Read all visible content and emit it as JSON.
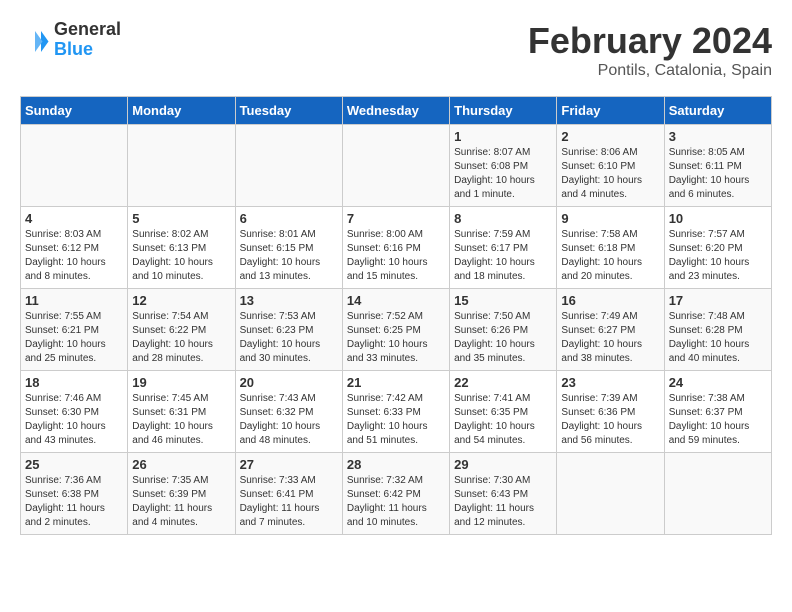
{
  "header": {
    "logo": {
      "general": "General",
      "blue": "Blue"
    },
    "month": "February 2024",
    "location": "Pontils, Catalonia, Spain"
  },
  "days_of_week": [
    "Sunday",
    "Monday",
    "Tuesday",
    "Wednesday",
    "Thursday",
    "Friday",
    "Saturday"
  ],
  "weeks": [
    [
      {
        "day": "",
        "info": ""
      },
      {
        "day": "",
        "info": ""
      },
      {
        "day": "",
        "info": ""
      },
      {
        "day": "",
        "info": ""
      },
      {
        "day": "1",
        "info": "Sunrise: 8:07 AM\nSunset: 6:08 PM\nDaylight: 10 hours and 1 minute."
      },
      {
        "day": "2",
        "info": "Sunrise: 8:06 AM\nSunset: 6:10 PM\nDaylight: 10 hours and 4 minutes."
      },
      {
        "day": "3",
        "info": "Sunrise: 8:05 AM\nSunset: 6:11 PM\nDaylight: 10 hours and 6 minutes."
      }
    ],
    [
      {
        "day": "4",
        "info": "Sunrise: 8:03 AM\nSunset: 6:12 PM\nDaylight: 10 hours and 8 minutes."
      },
      {
        "day": "5",
        "info": "Sunrise: 8:02 AM\nSunset: 6:13 PM\nDaylight: 10 hours and 10 minutes."
      },
      {
        "day": "6",
        "info": "Sunrise: 8:01 AM\nSunset: 6:15 PM\nDaylight: 10 hours and 13 minutes."
      },
      {
        "day": "7",
        "info": "Sunrise: 8:00 AM\nSunset: 6:16 PM\nDaylight: 10 hours and 15 minutes."
      },
      {
        "day": "8",
        "info": "Sunrise: 7:59 AM\nSunset: 6:17 PM\nDaylight: 10 hours and 18 minutes."
      },
      {
        "day": "9",
        "info": "Sunrise: 7:58 AM\nSunset: 6:18 PM\nDaylight: 10 hours and 20 minutes."
      },
      {
        "day": "10",
        "info": "Sunrise: 7:57 AM\nSunset: 6:20 PM\nDaylight: 10 hours and 23 minutes."
      }
    ],
    [
      {
        "day": "11",
        "info": "Sunrise: 7:55 AM\nSunset: 6:21 PM\nDaylight: 10 hours and 25 minutes."
      },
      {
        "day": "12",
        "info": "Sunrise: 7:54 AM\nSunset: 6:22 PM\nDaylight: 10 hours and 28 minutes."
      },
      {
        "day": "13",
        "info": "Sunrise: 7:53 AM\nSunset: 6:23 PM\nDaylight: 10 hours and 30 minutes."
      },
      {
        "day": "14",
        "info": "Sunrise: 7:52 AM\nSunset: 6:25 PM\nDaylight: 10 hours and 33 minutes."
      },
      {
        "day": "15",
        "info": "Sunrise: 7:50 AM\nSunset: 6:26 PM\nDaylight: 10 hours and 35 minutes."
      },
      {
        "day": "16",
        "info": "Sunrise: 7:49 AM\nSunset: 6:27 PM\nDaylight: 10 hours and 38 minutes."
      },
      {
        "day": "17",
        "info": "Sunrise: 7:48 AM\nSunset: 6:28 PM\nDaylight: 10 hours and 40 minutes."
      }
    ],
    [
      {
        "day": "18",
        "info": "Sunrise: 7:46 AM\nSunset: 6:30 PM\nDaylight: 10 hours and 43 minutes."
      },
      {
        "day": "19",
        "info": "Sunrise: 7:45 AM\nSunset: 6:31 PM\nDaylight: 10 hours and 46 minutes."
      },
      {
        "day": "20",
        "info": "Sunrise: 7:43 AM\nSunset: 6:32 PM\nDaylight: 10 hours and 48 minutes."
      },
      {
        "day": "21",
        "info": "Sunrise: 7:42 AM\nSunset: 6:33 PM\nDaylight: 10 hours and 51 minutes."
      },
      {
        "day": "22",
        "info": "Sunrise: 7:41 AM\nSunset: 6:35 PM\nDaylight: 10 hours and 54 minutes."
      },
      {
        "day": "23",
        "info": "Sunrise: 7:39 AM\nSunset: 6:36 PM\nDaylight: 10 hours and 56 minutes."
      },
      {
        "day": "24",
        "info": "Sunrise: 7:38 AM\nSunset: 6:37 PM\nDaylight: 10 hours and 59 minutes."
      }
    ],
    [
      {
        "day": "25",
        "info": "Sunrise: 7:36 AM\nSunset: 6:38 PM\nDaylight: 11 hours and 2 minutes."
      },
      {
        "day": "26",
        "info": "Sunrise: 7:35 AM\nSunset: 6:39 PM\nDaylight: 11 hours and 4 minutes."
      },
      {
        "day": "27",
        "info": "Sunrise: 7:33 AM\nSunset: 6:41 PM\nDaylight: 11 hours and 7 minutes."
      },
      {
        "day": "28",
        "info": "Sunrise: 7:32 AM\nSunset: 6:42 PM\nDaylight: 11 hours and 10 minutes."
      },
      {
        "day": "29",
        "info": "Sunrise: 7:30 AM\nSunset: 6:43 PM\nDaylight: 11 hours and 12 minutes."
      },
      {
        "day": "",
        "info": ""
      },
      {
        "day": "",
        "info": ""
      }
    ]
  ]
}
